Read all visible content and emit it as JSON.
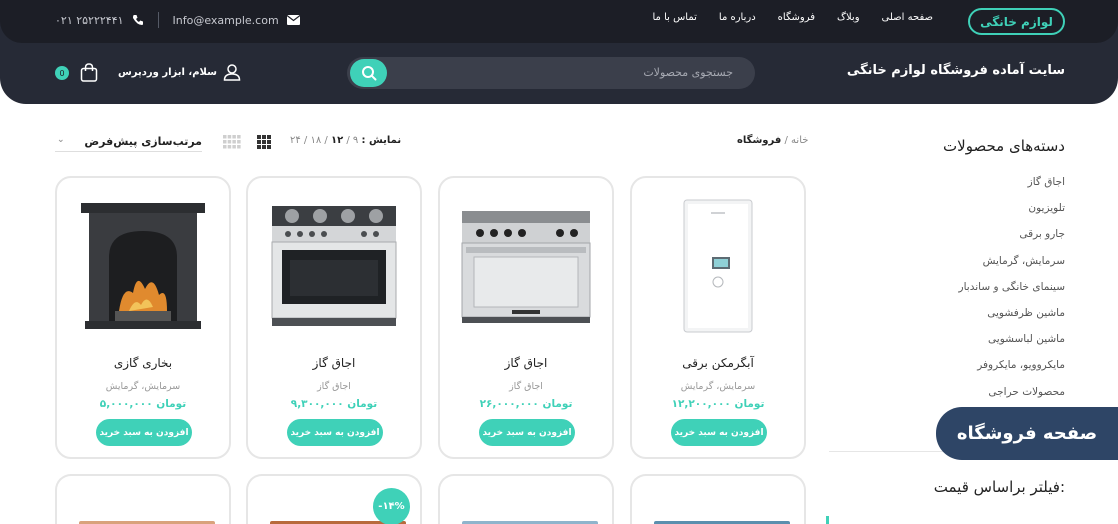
{
  "header": {
    "brand_button": "لوازم خانگی",
    "nav": [
      "صفحه اصلی",
      "وبلاگ",
      "فروشگاه",
      "درباره ما",
      "تماس با ما"
    ],
    "email": "Info@example.com",
    "phone": "۰۲۱ ۲۵۲۲۲۴۴۱",
    "site_title": "سایت آماده فروشگاه لوازم خانگی",
    "search_placeholder": "جستجوی محصولات",
    "greeting": "سلام، ابزار وردپرس",
    "cart_count": "0"
  },
  "sidebar": {
    "title": "دسته‌های محصولات",
    "categories": [
      "اجاق گاز",
      "تلویزیون",
      "جارو برقی",
      "سرمایش، گرمایش",
      "سینمای خانگی و ساندبار",
      "ماشین ظرفشویی",
      "ماشین لباسشویی",
      "مایکروویو، مایکروفر",
      "محصولات حراجی"
    ],
    "shop_badge": "صفحه فروشگاه",
    "filter_title": "فیلتر براساس قیمت:"
  },
  "toolbar": {
    "breadcrumb_home": "خانه",
    "breadcrumb_sep": "/",
    "breadcrumb_current": "فروشگاه",
    "show_label": "نمایش :",
    "show_options": [
      "۹",
      "۱۲",
      "۱۸",
      "۲۴"
    ],
    "sort_label": "مرتب‌سازی پیش‌فرض"
  },
  "products": [
    {
      "title": "آبگرمکن برقی",
      "category": "سرمایش، گرمایش",
      "price": "۱۲,۲۰۰,۰۰۰ تومان",
      "button": "افزودن به سبد خرید",
      "icon": "water-heater-icon"
    },
    {
      "title": "اجاق گاز",
      "category": "اجاق گاز",
      "price": "۲۶,۰۰۰,۰۰۰ تومان",
      "button": "افزودن به سبد خرید",
      "icon": "stove-icon"
    },
    {
      "title": "اجاق گاز",
      "category": "اجاق گاز",
      "price": "۹,۳۰۰,۰۰۰ تومان",
      "button": "افزودن به سبد خرید",
      "icon": "stove-icon"
    },
    {
      "title": "بخاری گازی",
      "category": "سرمایش، گرمایش",
      "price": "۵,۰۰۰,۰۰۰ تومان",
      "button": "افزودن به سبد خرید",
      "icon": "fireplace-icon"
    }
  ],
  "discount_badge": "-۱۴%",
  "colors": {
    "accent": "#3fd1b8",
    "header": "#262a36",
    "topbar": "#1c1e26",
    "badge": "#2e4566"
  }
}
